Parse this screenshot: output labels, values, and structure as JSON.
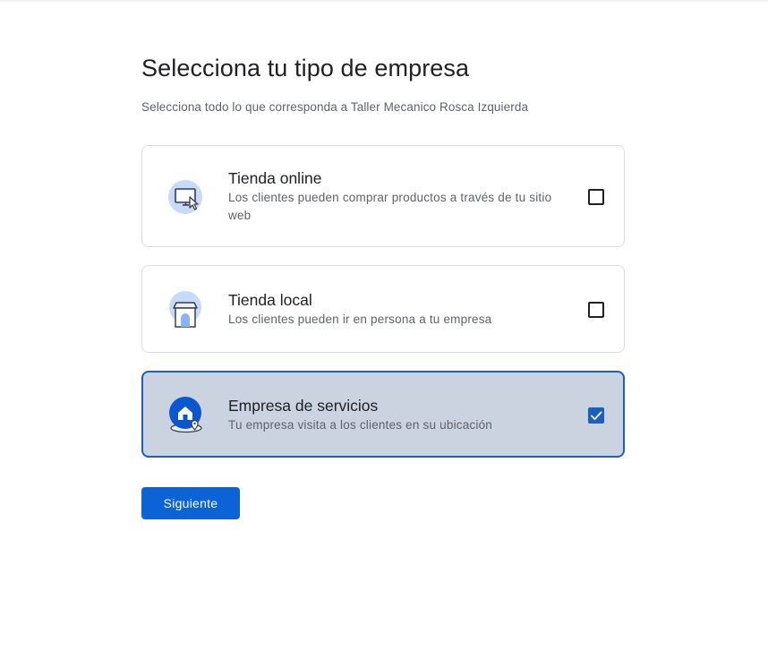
{
  "page": {
    "title": "Selecciona tu tipo de empresa",
    "subtitle": "Selecciona todo lo que corresponda a Taller Mecanico Rosca Izquierda"
  },
  "options": [
    {
      "title": "Tienda online",
      "description": "Los clientes pueden comprar productos a través de tu sitio web",
      "icon": "online-store-icon",
      "checked": false
    },
    {
      "title": "Tienda local",
      "description": "Los clientes pueden ir en persona a tu empresa",
      "icon": "local-store-icon",
      "checked": false
    },
    {
      "title": "Empresa de servicios",
      "description": "Tu empresa visita a los clientes en su ubicación",
      "icon": "service-business-icon",
      "checked": true
    }
  ],
  "actions": {
    "next_label": "Siguiente"
  },
  "colors": {
    "accent": "#0b63d6",
    "selected_border": "#1a5fc4",
    "selected_bg": "#cbd3e1",
    "icon_light_blue": "#c6dafc",
    "icon_dark_blue": "#0b57d0"
  }
}
